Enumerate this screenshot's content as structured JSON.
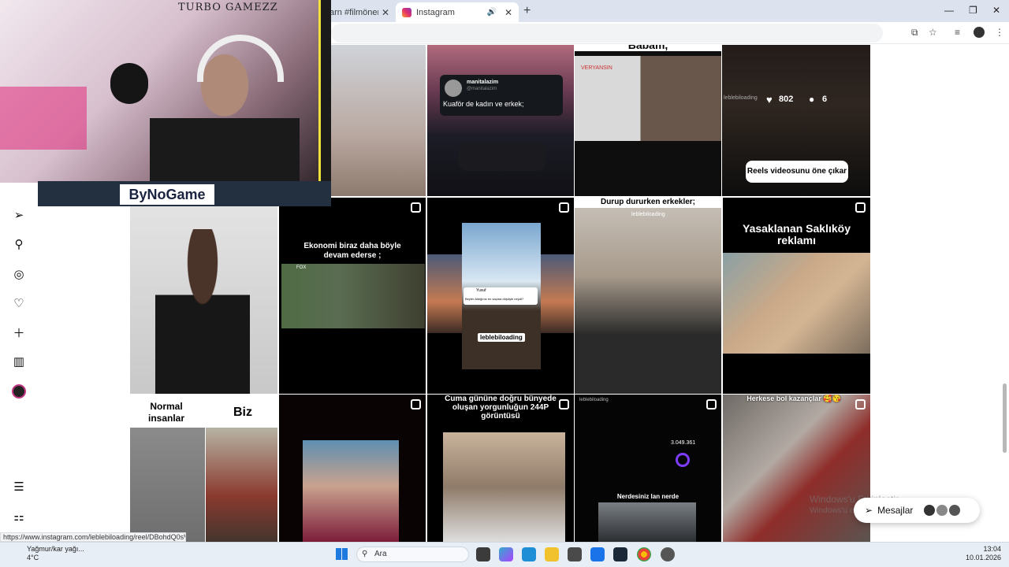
{
  "browser": {
    "tabs": [
      {
        "label": "arn #filmönerile",
        "active": false
      },
      {
        "label": "Instagram",
        "active": true
      }
    ],
    "new_tab_symbol": "+",
    "window_controls": [
      "—",
      "❐",
      "✕"
    ],
    "status_url": "https://www.instagram.com/leblebiloading/reel/DBohdQ0sVGG/"
  },
  "overlay": {
    "channel_name": "TURBO GAMEZZ",
    "sponsor": "ByNoGame"
  },
  "nav_icons": [
    "reels-icon",
    "send-icon",
    "search-icon",
    "explore-icon",
    "heart-icon",
    "create-icon",
    "insights-icon",
    "profile-icon",
    "menu-icon",
    "apps-icon"
  ],
  "grid": {
    "row1": [
      {
        "caption": ""
      },
      {
        "tweet_user": "manitalazim",
        "tweet_handle": "@manitalazim",
        "tweet_text": "Kuaför de kadın ve erkek;"
      },
      {
        "caption": "Babam,",
        "badge": "VERYANSIN"
      },
      {
        "badge": "leblebiloading",
        "likes": "802",
        "comments": "6",
        "cta": "Reels videosunu öne çıkar"
      }
    ],
    "row2": [
      {
        "caption": ""
      },
      {
        "caption": "Ekonomi biraz daha böyle devam ederse ;",
        "badge": "FOX"
      },
      {
        "caption": "leblebiloading",
        "tweet_user": "Yusuf",
        "tweet_text": "Beyler Aldığınız en saçma düşüşle neydi?"
      },
      {
        "caption": "Durup dururken erkekler;",
        "badge": "leblebiloading"
      },
      {
        "caption": "Yasaklanan Saklıköy reklamı"
      }
    ],
    "row3": [
      {
        "caption_left": "Normal insanlar",
        "caption_right": "Biz"
      },
      {
        "caption": ""
      },
      {
        "caption": "Cuma gününe doğru bünyede oluşan yorgunluğun 244P görüntüsü"
      },
      {
        "caption": "Nerdesiniz lan nerde",
        "badge": "leblebiloading",
        "stat": "3.049.361"
      },
      {
        "caption": "Herkese bol kazançlar 🥰😘"
      }
    ]
  },
  "messages_label": "Mesajlar",
  "activation": {
    "line1": "Windows'u Etkinleştir",
    "line2": "Windows'u etkinleştirmek için Ayarlar'a gidin."
  },
  "taskbar": {
    "weather_temp": "4°C",
    "weather_text": "Yağmur/kar yağı...",
    "search_placeholder": "Ara",
    "time": "13:04",
    "date": "10.01.2026"
  }
}
